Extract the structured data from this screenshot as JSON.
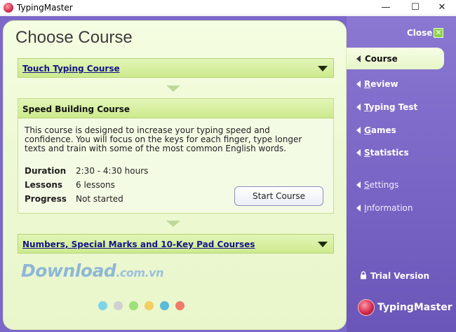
{
  "window": {
    "title": "TypingMaster",
    "minimize": "—",
    "maximize": "☐",
    "close": "✕"
  },
  "page": {
    "title": "Choose Course"
  },
  "courses": {
    "touch_typing": "Touch Typing Course",
    "speed_building": {
      "title": "Speed Building Course",
      "description": "This course is designed to increase your typing speed and confidence. You will focus on the keys for each finger, type longer texts and train with some of the most common English words.",
      "duration_label": "Duration",
      "duration_value": "2:30 - 4:30 hours",
      "lessons_label": "Lessons",
      "lessons_value": "6 lessons",
      "progress_label": "Progress",
      "progress_value": "Not started",
      "start_button": "Start Course"
    },
    "numbers": "Numbers, Special Marks and 10-Key Pad Courses"
  },
  "sidebar": {
    "close_label": "Close",
    "close_icon": "✕",
    "items": [
      {
        "first": "",
        "rest": "Course"
      },
      {
        "first": "R",
        "rest": "eview"
      },
      {
        "first": "T",
        "rest": "yping Test"
      },
      {
        "first": "G",
        "rest": "ames"
      },
      {
        "first": "S",
        "rest": "tatistics"
      },
      {
        "first": "S",
        "rest": "ettings"
      },
      {
        "first": "I",
        "rest": "nformation"
      }
    ],
    "trial": "Trial Version",
    "brand": "TypingMaster"
  },
  "watermark": {
    "main": "Download",
    "suffix": ".com.vn",
    "dot_colors": [
      "#7fd3e8",
      "#cfd1cf",
      "#9ee07a",
      "#f2cf61",
      "#5bb9d9",
      "#ef7a6a"
    ]
  }
}
